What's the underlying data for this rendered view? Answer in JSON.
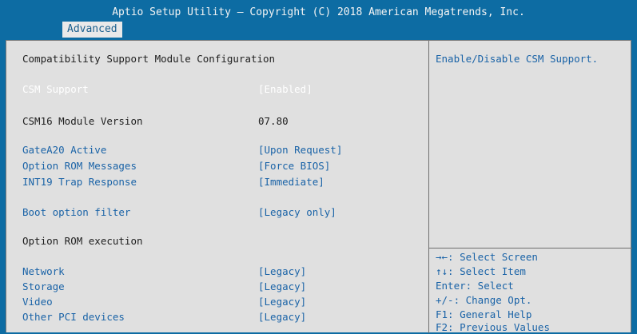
{
  "header": {
    "title": "Aptio Setup Utility – Copyright (C) 2018 American Megatrends, Inc.",
    "tab": "Advanced"
  },
  "main": {
    "section_title": "Compatibility Support Module Configuration",
    "csm_support": {
      "label": "CSM Support",
      "value": "[Enabled]"
    },
    "csm16_version": {
      "label": "CSM16 Module Version",
      "value": "07.80"
    },
    "gatea20": {
      "label": "GateA20 Active",
      "value": "[Upon Request]"
    },
    "option_rom_messages": {
      "label": "Option ROM Messages",
      "value": "[Force BIOS]"
    },
    "int19": {
      "label": "INT19 Trap Response",
      "value": "[Immediate]"
    },
    "boot_filter": {
      "label": "Boot option filter",
      "value": "[Legacy only]"
    },
    "option_rom_execution": "Option ROM execution",
    "network": {
      "label": "Network",
      "value": "[Legacy]"
    },
    "storage": {
      "label": "Storage",
      "value": "[Legacy]"
    },
    "video": {
      "label": "Video",
      "value": "[Legacy]"
    },
    "other_pci": {
      "label": "Other PCI devices",
      "value": "[Legacy]"
    }
  },
  "help": {
    "text": "Enable/Disable CSM Support.",
    "keys": [
      "→←: Select Screen",
      "↑↓: Select Item",
      "Enter: Select",
      "+/-: Change Opt.",
      "F1: General Help",
      "F2: Previous Values"
    ]
  }
}
